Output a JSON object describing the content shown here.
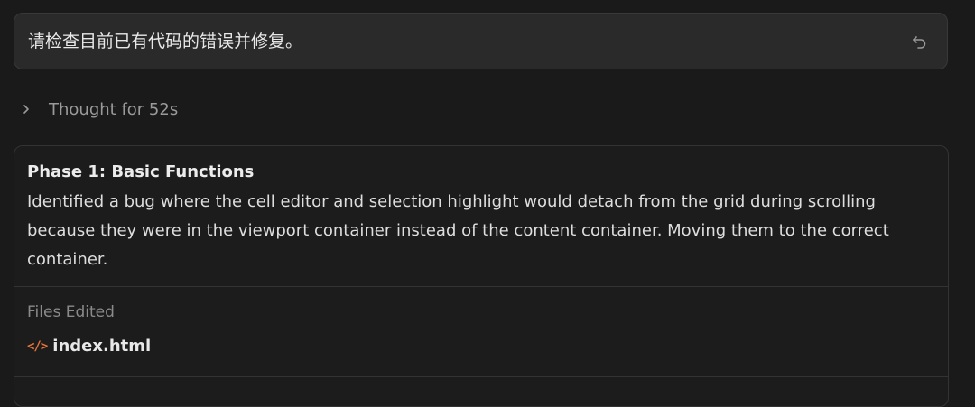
{
  "user_message": {
    "text": "请检查目前已有代码的错误并修复。",
    "action_icon": "undo-icon"
  },
  "thought": {
    "label": "Thought for 52s",
    "icon": "chevron-right-icon"
  },
  "step": {
    "title": "Phase 1: Basic Functions",
    "description": "Identified a bug where the cell editor and selection highlight would detach from the grid during scrolling because they were in the viewport container instead of the content container. Moving them to the correct container.",
    "files_label": "Files Edited",
    "files": [
      {
        "name": "index.html",
        "icon": "code-icon",
        "icon_glyph": "</>",
        "icon_color": "#e0743b"
      }
    ]
  }
}
